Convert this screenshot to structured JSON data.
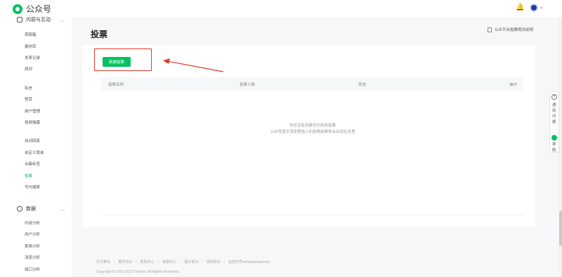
{
  "header": {
    "app_name": "公众号",
    "avatar_caret": "⌄"
  },
  "sidebar": {
    "group1": {
      "label": "内容与互动"
    },
    "items_a": [
      "草稿箱",
      "素材库",
      "发表记录",
      "原创"
    ],
    "items_b": [
      "私信",
      "赞赏",
      "用户管理",
      "视频弹幕"
    ],
    "items_c": [
      "自动回复",
      "自定义菜单",
      "合集标签",
      "投票",
      "号内搜索"
    ],
    "active_item": "投票",
    "group2": {
      "label": "数据"
    },
    "items_d": [
      "内容分析",
      "用户分析",
      "菜单分析",
      "消息分析",
      "接口分析"
    ]
  },
  "main": {
    "title": "投票",
    "rules_link": "公众平台投票规则说明",
    "new_button": "新建投票",
    "columns": [
      "投票名称",
      "投票人数",
      "状态",
      "操作"
    ],
    "empty_line1": "你还没有创建任何有效投票",
    "empty_line2": "公众号图文消息里插入的投票结果将会出现在这里"
  },
  "footer": {
    "links": [
      "关于腾讯",
      "服务协议",
      "帮助中心",
      "客服中心",
      "图片素材",
      "侵权投诉",
      "运营商号weixingongzhong"
    ],
    "copyright": "Copyright © 2012-2022 Tencent. All Rights Reserved."
  },
  "float_panel": {
    "feedback": "遇到问题",
    "nav": "导航"
  },
  "colors": {
    "accent": "#07c160",
    "highlight": "#e03b2c"
  }
}
